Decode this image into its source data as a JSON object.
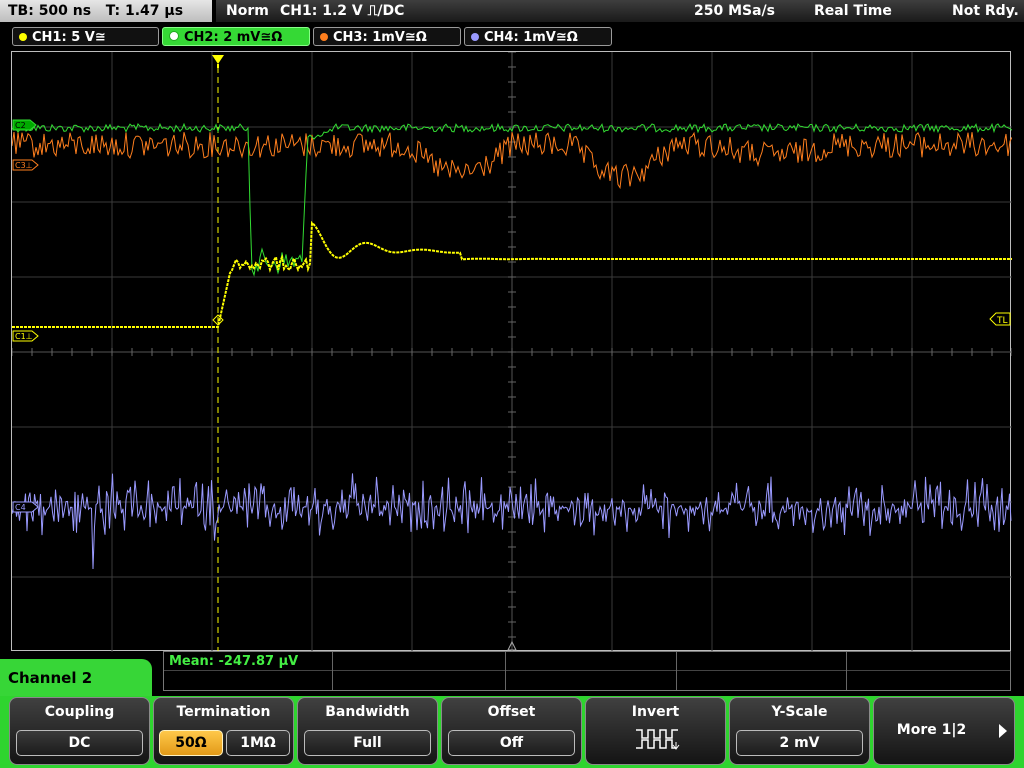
{
  "topbar": {
    "timebase": "TB: 500 ns",
    "trigger_time": "T: 1.47 µs",
    "mode": "Norm",
    "trigger_setting": "CH1: 1.2 V ⎍/DC",
    "sample_rate": "250 MSa/s",
    "acquisition": "Real Time",
    "status": "Not Rdy."
  },
  "channels": [
    {
      "label": "CH1: 5 V≅",
      "color": "#ffff00"
    },
    {
      "label": "CH2: 2 mV≅Ω",
      "color": "#33dd33"
    },
    {
      "label": "CH3: 1mV≅Ω",
      "color": "#ff7f1e"
    },
    {
      "label": "CH4: 1mV≅Ω",
      "color": "#9a9aff"
    }
  ],
  "markers": {
    "c2": "C2",
    "c3": "C3⊥",
    "c1": "C1⊥",
    "c4": "C4",
    "trigger_level": "TL"
  },
  "measurement": {
    "mean": "Mean: -247.87 µV"
  },
  "channel_tab": "Channel 2",
  "softkeys": {
    "coupling": {
      "title": "Coupling",
      "value": "DC"
    },
    "termination": {
      "title": "Termination",
      "option1": "50Ω",
      "option2": "1MΩ"
    },
    "bandwidth": {
      "title": "Bandwidth",
      "value": "Full"
    },
    "offset": {
      "title": "Offset",
      "value": "Off"
    },
    "invert": {
      "title": "Invert"
    },
    "yscale": {
      "title": "Y-Scale",
      "value": "2 mV"
    },
    "more": {
      "label": "More 1|2"
    }
  }
}
